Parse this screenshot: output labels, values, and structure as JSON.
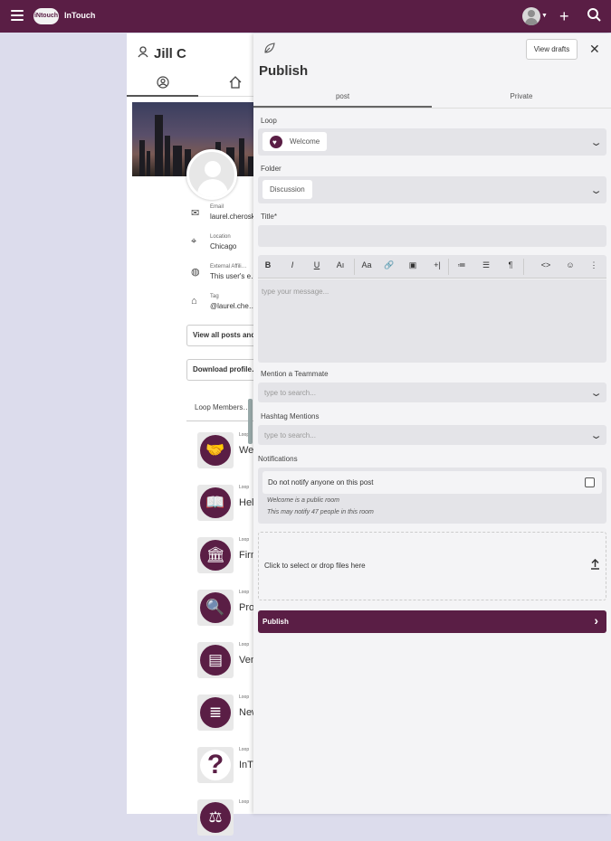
{
  "topbar": {
    "logo": "iNtouch",
    "brand": "InTouch",
    "add_icon": "+",
    "search_icon": "⌕"
  },
  "profile": {
    "name": "Jill C",
    "info": [
      {
        "label": "Email",
        "value": "laurel.cheroske@…",
        "icon": "envelope-icon"
      },
      {
        "label": "Location",
        "value": "Chicago",
        "icon": "map-pin-icon"
      },
      {
        "label": "External Affili…",
        "value": "This user's e…",
        "icon": "globe-icon"
      },
      {
        "label": "Tag",
        "value": "@laurel.che…",
        "icon": "tag-icon"
      }
    ],
    "view_posts_button": "View all posts and…",
    "download_profile_button": "Download profile…",
    "loop_members_tab": "Loop Members…",
    "loops": [
      {
        "small": "Loop",
        "name": "Welcome",
        "icon": "handshake-icon",
        "glyph": "🤝"
      },
      {
        "small": "Loop",
        "name": "Help",
        "icon": "book-icon",
        "glyph": "📖"
      },
      {
        "small": "Loop",
        "name": "Firm",
        "icon": "building-icon",
        "glyph": "🏛"
      },
      {
        "small": "Loop",
        "name": "Pro…",
        "icon": "search-doc-icon",
        "glyph": "🔍"
      },
      {
        "small": "Loop",
        "name": "Ven…",
        "icon": "card-icon",
        "glyph": "▤"
      },
      {
        "small": "Loop",
        "name": "New…",
        "icon": "document-icon",
        "glyph": "≣"
      },
      {
        "small": "Loop",
        "name": "InT…",
        "icon": "question-icon",
        "glyph": "?"
      },
      {
        "small": "Loop",
        "name": "",
        "icon": "scale-icon",
        "glyph": "⚖"
      }
    ]
  },
  "publish": {
    "title": "Publish",
    "view_drafts": "View drafts",
    "tabs": [
      "post",
      "Private"
    ],
    "loop_label": "Loop",
    "loop_value": "Welcome",
    "folder_label": "Folder",
    "folder_value": "Discussion",
    "title_label": "Title*",
    "editor_placeholder": "type your message...",
    "mention_label": "Mention a Teammate",
    "mention_placeholder": "type to search...",
    "hashtag_label": "Hashtag Mentions",
    "hashtag_placeholder": "type to search...",
    "notifications_label": "Notifications",
    "notify_option": "Do not notify anyone on this post",
    "note_public": "Welcome is a public room",
    "note_notify": "This may notify 47 people in this room",
    "drop_text": "Click to select or drop files here",
    "publish_button": "Publish",
    "toolbar": [
      "B",
      "I",
      "U",
      "Aı",
      "Aa",
      "🔗",
      "▣",
      "+|",
      "≔",
      "☰",
      "¶",
      "<>",
      "☺",
      "⋮"
    ]
  },
  "colors": {
    "brand": "#5a1e45",
    "panel": "#f4f4f6",
    "field": "#e4e4e8"
  }
}
